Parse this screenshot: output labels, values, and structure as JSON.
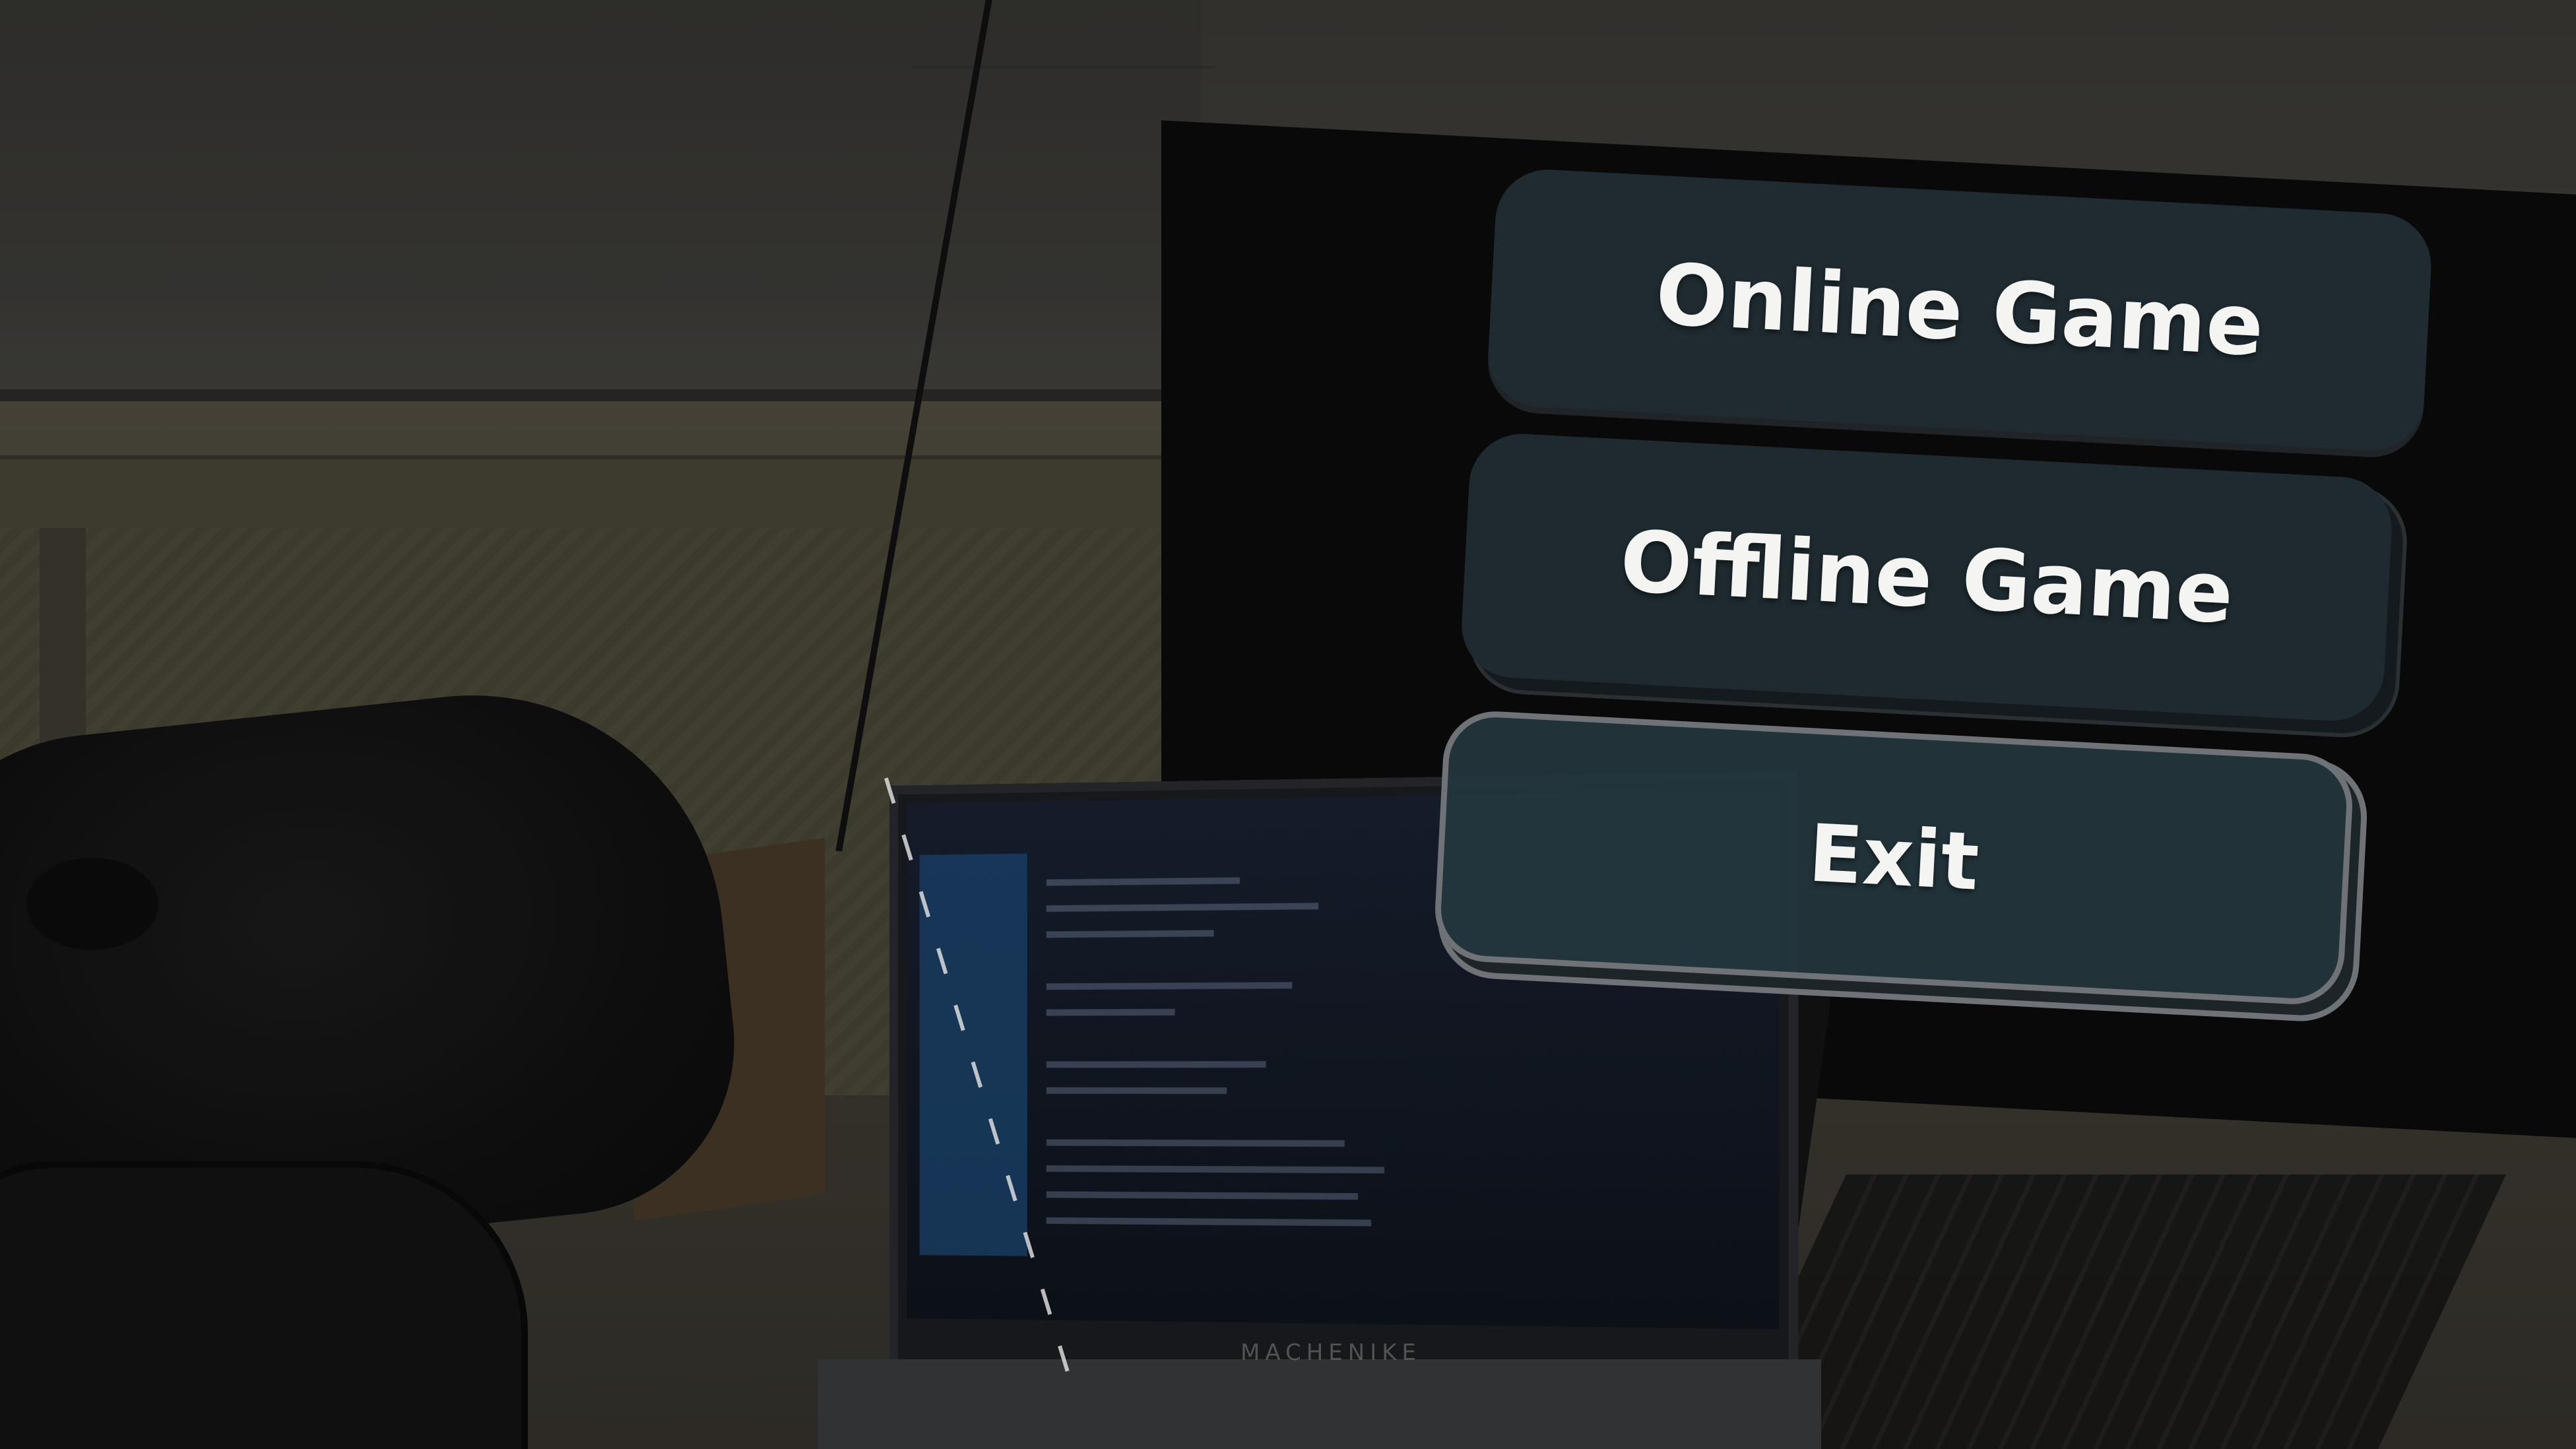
{
  "menu": {
    "online_label": "Online Game",
    "offline_label": "Offline Game",
    "exit_label": "Exit"
  },
  "background": {
    "laptop_brand": "MACHENIKE"
  },
  "colors": {
    "button_fill": "#1f2b31",
    "exit_fill": "#24363e",
    "exit_outline": "#6f7377",
    "label_text": "#f4f4f2"
  }
}
